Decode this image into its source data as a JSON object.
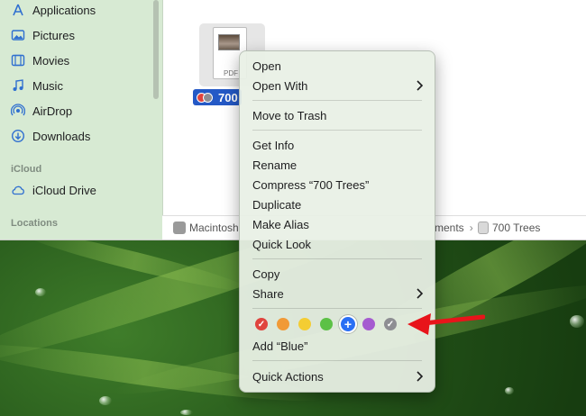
{
  "sidebar": {
    "items": [
      {
        "label": "Applications",
        "icon": "applications-icon"
      },
      {
        "label": "Pictures",
        "icon": "pictures-icon"
      },
      {
        "label": "Movies",
        "icon": "movies-icon"
      },
      {
        "label": "Music",
        "icon": "music-icon"
      },
      {
        "label": "AirDrop",
        "icon": "airdrop-icon"
      },
      {
        "label": "Downloads",
        "icon": "downloads-icon"
      }
    ],
    "icloud_header": "iCloud",
    "icloud_drive": "iCloud Drive",
    "locations_header": "Locations"
  },
  "file": {
    "name": "700",
    "type_label": "PDF"
  },
  "pathbar": {
    "segments": [
      "Macintosh",
      "ments",
      "700 Trees"
    ]
  },
  "context_menu": {
    "open": "Open",
    "open_with": "Open With",
    "move_to_trash": "Move to Trash",
    "get_info": "Get Info",
    "rename": "Rename",
    "compress": "Compress “700 Trees”",
    "duplicate": "Duplicate",
    "make_alias": "Make Alias",
    "quick_look": "Quick Look",
    "copy": "Copy",
    "share": "Share",
    "add_tag": "Add “Blue”",
    "quick_actions": "Quick Actions",
    "tag_colors": [
      {
        "name": "red",
        "hex": "#e0443e",
        "mark": "✓"
      },
      {
        "name": "orange",
        "hex": "#f19a37",
        "mark": ""
      },
      {
        "name": "yellow",
        "hex": "#f4cd33",
        "mark": ""
      },
      {
        "name": "green",
        "hex": "#5cc146",
        "mark": ""
      },
      {
        "name": "blue",
        "hex": "#2a6ff4",
        "mark": "+"
      },
      {
        "name": "purple",
        "hex": "#a55bd0",
        "mark": ""
      },
      {
        "name": "gray",
        "hex": "#8e8e93",
        "mark": "✓"
      }
    ]
  },
  "annotation": {
    "arrow_color": "#e8141a"
  }
}
